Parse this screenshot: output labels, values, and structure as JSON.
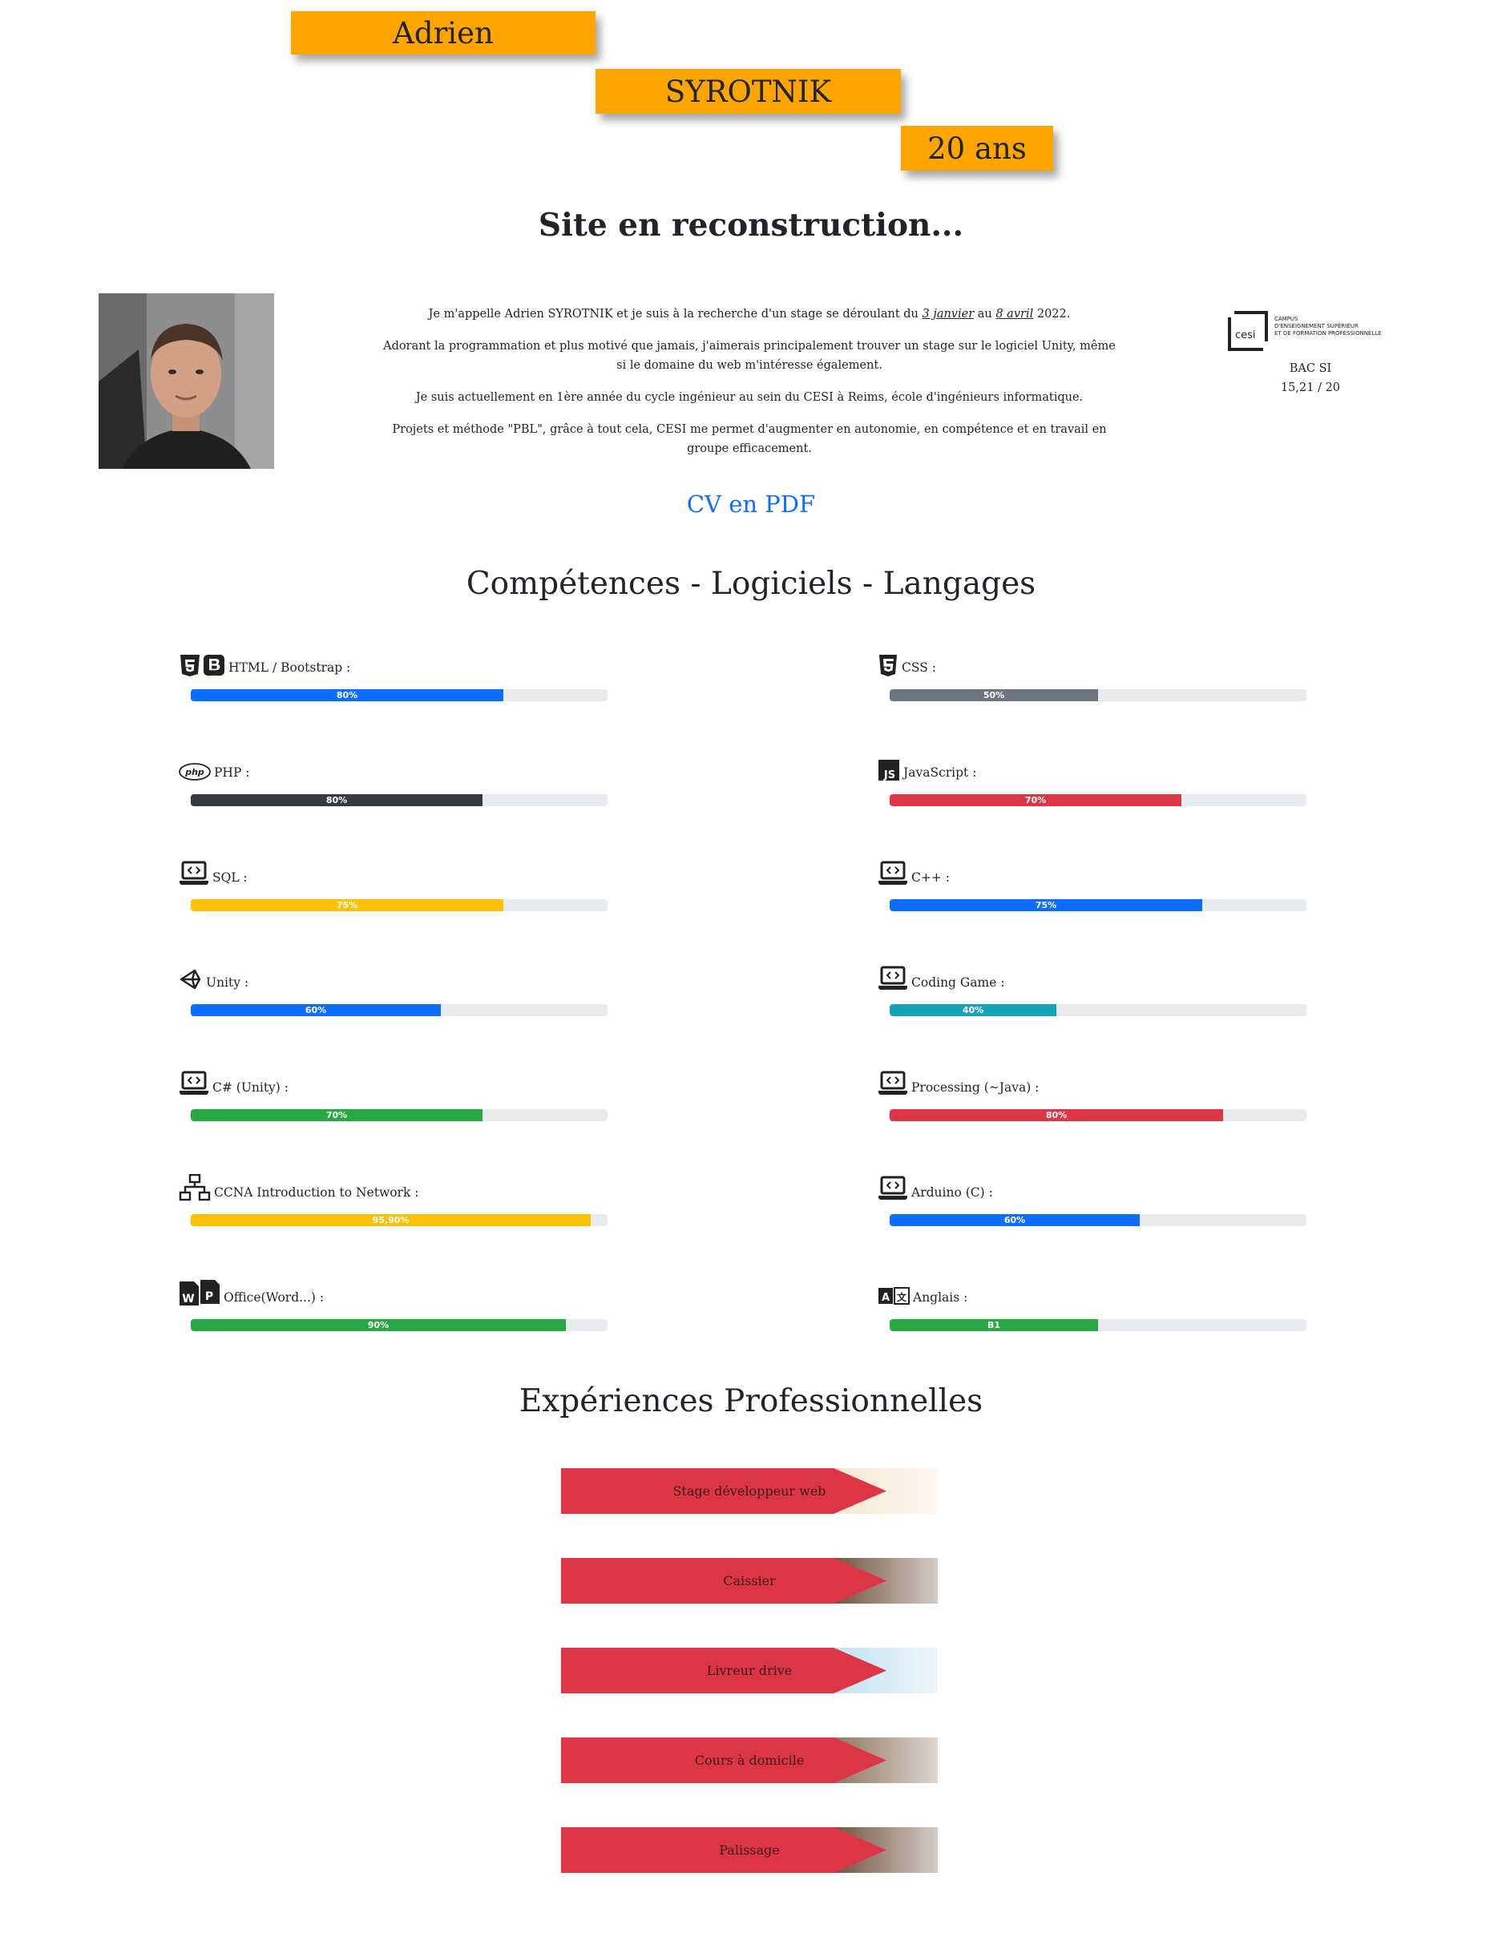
{
  "header": {
    "first_name": "Adrien",
    "last_name": "SYROTNIK",
    "age": "20 ans",
    "site_status": "Site en reconstruction..."
  },
  "intro": {
    "p1_before": "Je m'appelle Adrien SYROTNIK et je suis à la recherche d'un stage se déroulant du ",
    "p1_date_start": "3 janvier",
    "p1_middle": " au ",
    "p1_date_end": "8 avril",
    "p1_after": " 2022.",
    "p2": "Adorant la programmation et plus motivé que jamais, j'aimerais principalement trouver un stage sur le logiciel Unity, même si le domaine du web m'intéresse également.",
    "p3": "Je suis actuellement en 1ère année du cycle ingénieur au sein du CESI à Reims, école d'ingénieurs informatique.",
    "p4": "Projets et méthode \"PBL\", grâce à tout cela, CESI me permet d'augmenter en autonomie, en compétence et en travail en groupe efficacement."
  },
  "school": {
    "logo_text": "cesi",
    "logo_caption_1": "CAMPUS",
    "logo_caption_2": "D'ENSEIGNEMENT SUPÉRIEUR",
    "logo_caption_3": "ET DE FORMATION PROFESSIONNELLE",
    "diploma": "BAC SI",
    "grade": "15,21 / 20"
  },
  "cv_link": "CV en PDF",
  "skills_title": "Compétences - Logiciels - Langages",
  "skills": [
    {
      "label": "HTML / Bootstrap :",
      "icon": "html5-bootstrap-icon",
      "value": 0.75,
      "text": "80%",
      "color": "#0d6efd"
    },
    {
      "label": "CSS :",
      "icon": "css3-icon",
      "value": 0.5,
      "text": "50%",
      "color": "#6c757d"
    },
    {
      "label": "PHP :",
      "icon": "php-icon",
      "value": 0.7,
      "text": "80%",
      "color": "#343a40"
    },
    {
      "label": "JavaScript :",
      "icon": "javascript-icon",
      "value": 0.7,
      "text": "70%",
      "color": "#dc3545"
    },
    {
      "label": "SQL :",
      "icon": "laptop-code-icon",
      "value": 0.75,
      "text": "75%",
      "color": "#ffc107"
    },
    {
      "label": "C++ :",
      "icon": "laptop-code-icon",
      "value": 0.75,
      "text": "75%",
      "color": "#0d6efd"
    },
    {
      "label": "Unity :",
      "icon": "unity-icon",
      "value": 0.6,
      "text": "60%",
      "color": "#0d6efd"
    },
    {
      "label": "Coding Game :",
      "icon": "laptop-code-icon",
      "value": 0.4,
      "text": "40%",
      "color": "#17a2b8"
    },
    {
      "label": "C# (Unity) :",
      "icon": "laptop-code-icon",
      "value": 0.7,
      "text": "70%",
      "color": "#28a745"
    },
    {
      "label": "Processing (~Java) :",
      "icon": "laptop-code-icon",
      "value": 0.8,
      "text": "80%",
      "color": "#dc3545"
    },
    {
      "label": "CCNA Introduction to Network :",
      "icon": "network-icon",
      "value": 0.96,
      "text": "95,90%",
      "color": "#ffc107"
    },
    {
      "label": "Arduino (C) :",
      "icon": "laptop-code-icon",
      "value": 0.6,
      "text": "60%",
      "color": "#0d6efd"
    },
    {
      "label": "Office(Word...) :",
      "icon": "word-powerpoint-icon",
      "value": 0.9,
      "text": "90%",
      "color": "#28a745"
    },
    {
      "label": "Anglais :",
      "icon": "translate-icon",
      "value": 0.5,
      "text": "B1",
      "color": "#28a745"
    }
  ],
  "experience_title": "Expériences Professionnelles",
  "experiences": [
    {
      "label": "Stage développeur web",
      "thumb": "#f4e6cf"
    },
    {
      "label": "Caissier",
      "thumb": "#6b4a35"
    },
    {
      "label": "Livreur drive",
      "thumb": "#bfe0f2"
    },
    {
      "label": "Cours à domicile",
      "thumb": "#8a6e58"
    },
    {
      "label": "Palissage",
      "thumb": "#6b4a35"
    }
  ],
  "colors": {
    "accent_orange": "#ffa500",
    "link_blue": "#0d6efd",
    "arrow_red": "#dc3545"
  }
}
